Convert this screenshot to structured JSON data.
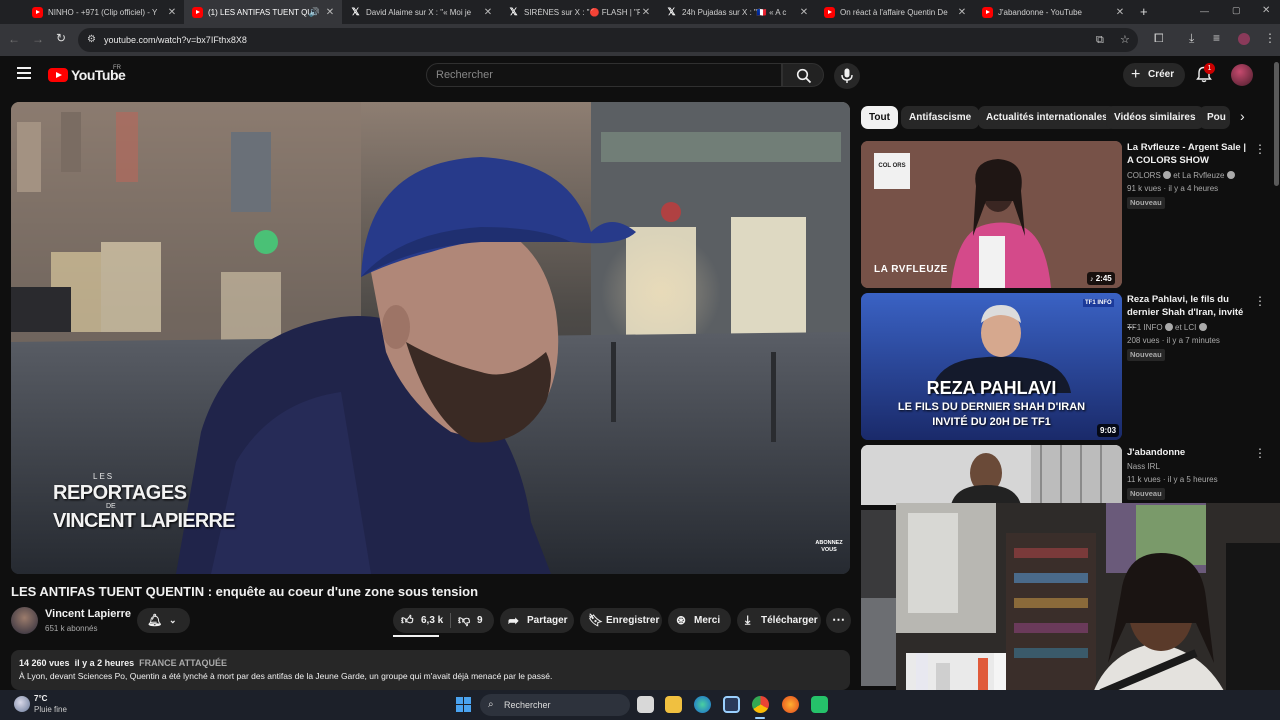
{
  "browser": {
    "tabs": [
      {
        "title": "NINHO - +971 (Clip officiel) - Y",
        "icon": "youtube"
      },
      {
        "title": "(1) LES ANTIFAS TUENT QU",
        "icon": "youtube"
      },
      {
        "title": "David Alaime sur X : \"« Moi je",
        "icon": "x"
      },
      {
        "title": "SIRÈNES sur X : \"🔴 FLASH | \"P",
        "icon": "x"
      },
      {
        "title": "24h Pujadas sur X : \"🇫🇷 « A c",
        "icon": "x"
      },
      {
        "title": "On réact à l'affaire Quentin De",
        "icon": "youtube"
      },
      {
        "title": "J'abandonne - YouTube",
        "icon": "youtube"
      }
    ],
    "url": "youtube.com/watch?v=bx7IFthx8X8"
  },
  "yt": {
    "logo_text": "YouTube",
    "logo_region": "FR",
    "search_placeholder": "Rechercher",
    "create_label": "Créer",
    "notif_count": "1"
  },
  "player": {
    "overlay_line1": "LES",
    "overlay_line2": "REPORTAGES",
    "overlay_line3": "DE",
    "overlay_line4": "VINCENT LAPIERRE",
    "watermark": "ABONNEZ VOUS"
  },
  "video": {
    "title": "LES ANTIFAS TUENT QUENTIN : enquête au coeur d'une zone sous tension",
    "channel": "Vincent Lapierre",
    "subscribers": "651 k abonnés",
    "likes": "6,3 k",
    "dislikes": "9",
    "share_label": "Partager",
    "save_label": "Enregistrer",
    "thanks_label": "Merci",
    "download_label": "Télécharger",
    "views": "14 260 vues",
    "age": "il y a 2 heures",
    "tag": "FRANCE ATTAQUÉE",
    "description": "À Lyon, devant Sciences Po, Quentin a été lynché à mort par des antifas de la Jeune Garde, un groupe qui m'avait déjà menacé par le passé."
  },
  "chips": [
    "Tout",
    "Antifascisme",
    "Actualités internationales",
    "Vidéos similaires",
    "Pou"
  ],
  "recommendations": [
    {
      "title": "La Rvfleuze - Argent Sale | A COLORS SHOW",
      "channel": "COLORS",
      "channel2": "et La Rvfleuze",
      "meta": "91 k vues · il y a 4 heures",
      "badge": "Nouveau",
      "duration": "2:45",
      "thumb_text": "LA RVFLEUZE",
      "thumb_logo": "COL ORS"
    },
    {
      "title": "Reza Pahlavi, le fils du dernier Shah d'Iran, invité ...",
      "channel": "TF1 INFO",
      "channel2": "et LCI",
      "meta": "208 vues · il y a 7 minutes",
      "badge": "Nouveau",
      "duration": "9:03",
      "thumb_text1": "REZA PAHLAVI",
      "thumb_text2": "LE FILS DU DERNIER SHAH D'IRAN",
      "thumb_text3": "INVITÉ DU 20H DE TF1",
      "thumb_logo": "TF1 INFO"
    },
    {
      "title": "J'abandonne",
      "channel": "Nass IRL",
      "meta": "11 k vues · il y a 5 heures",
      "badge": "Nouveau"
    }
  ],
  "taskbar": {
    "temp": "7°C",
    "weather": "Pluie fine",
    "search_label": "Rechercher"
  },
  "colors": {
    "yt_red": "#ff0000",
    "bg": "#0f0f0f",
    "chip_bg": "#272727"
  }
}
